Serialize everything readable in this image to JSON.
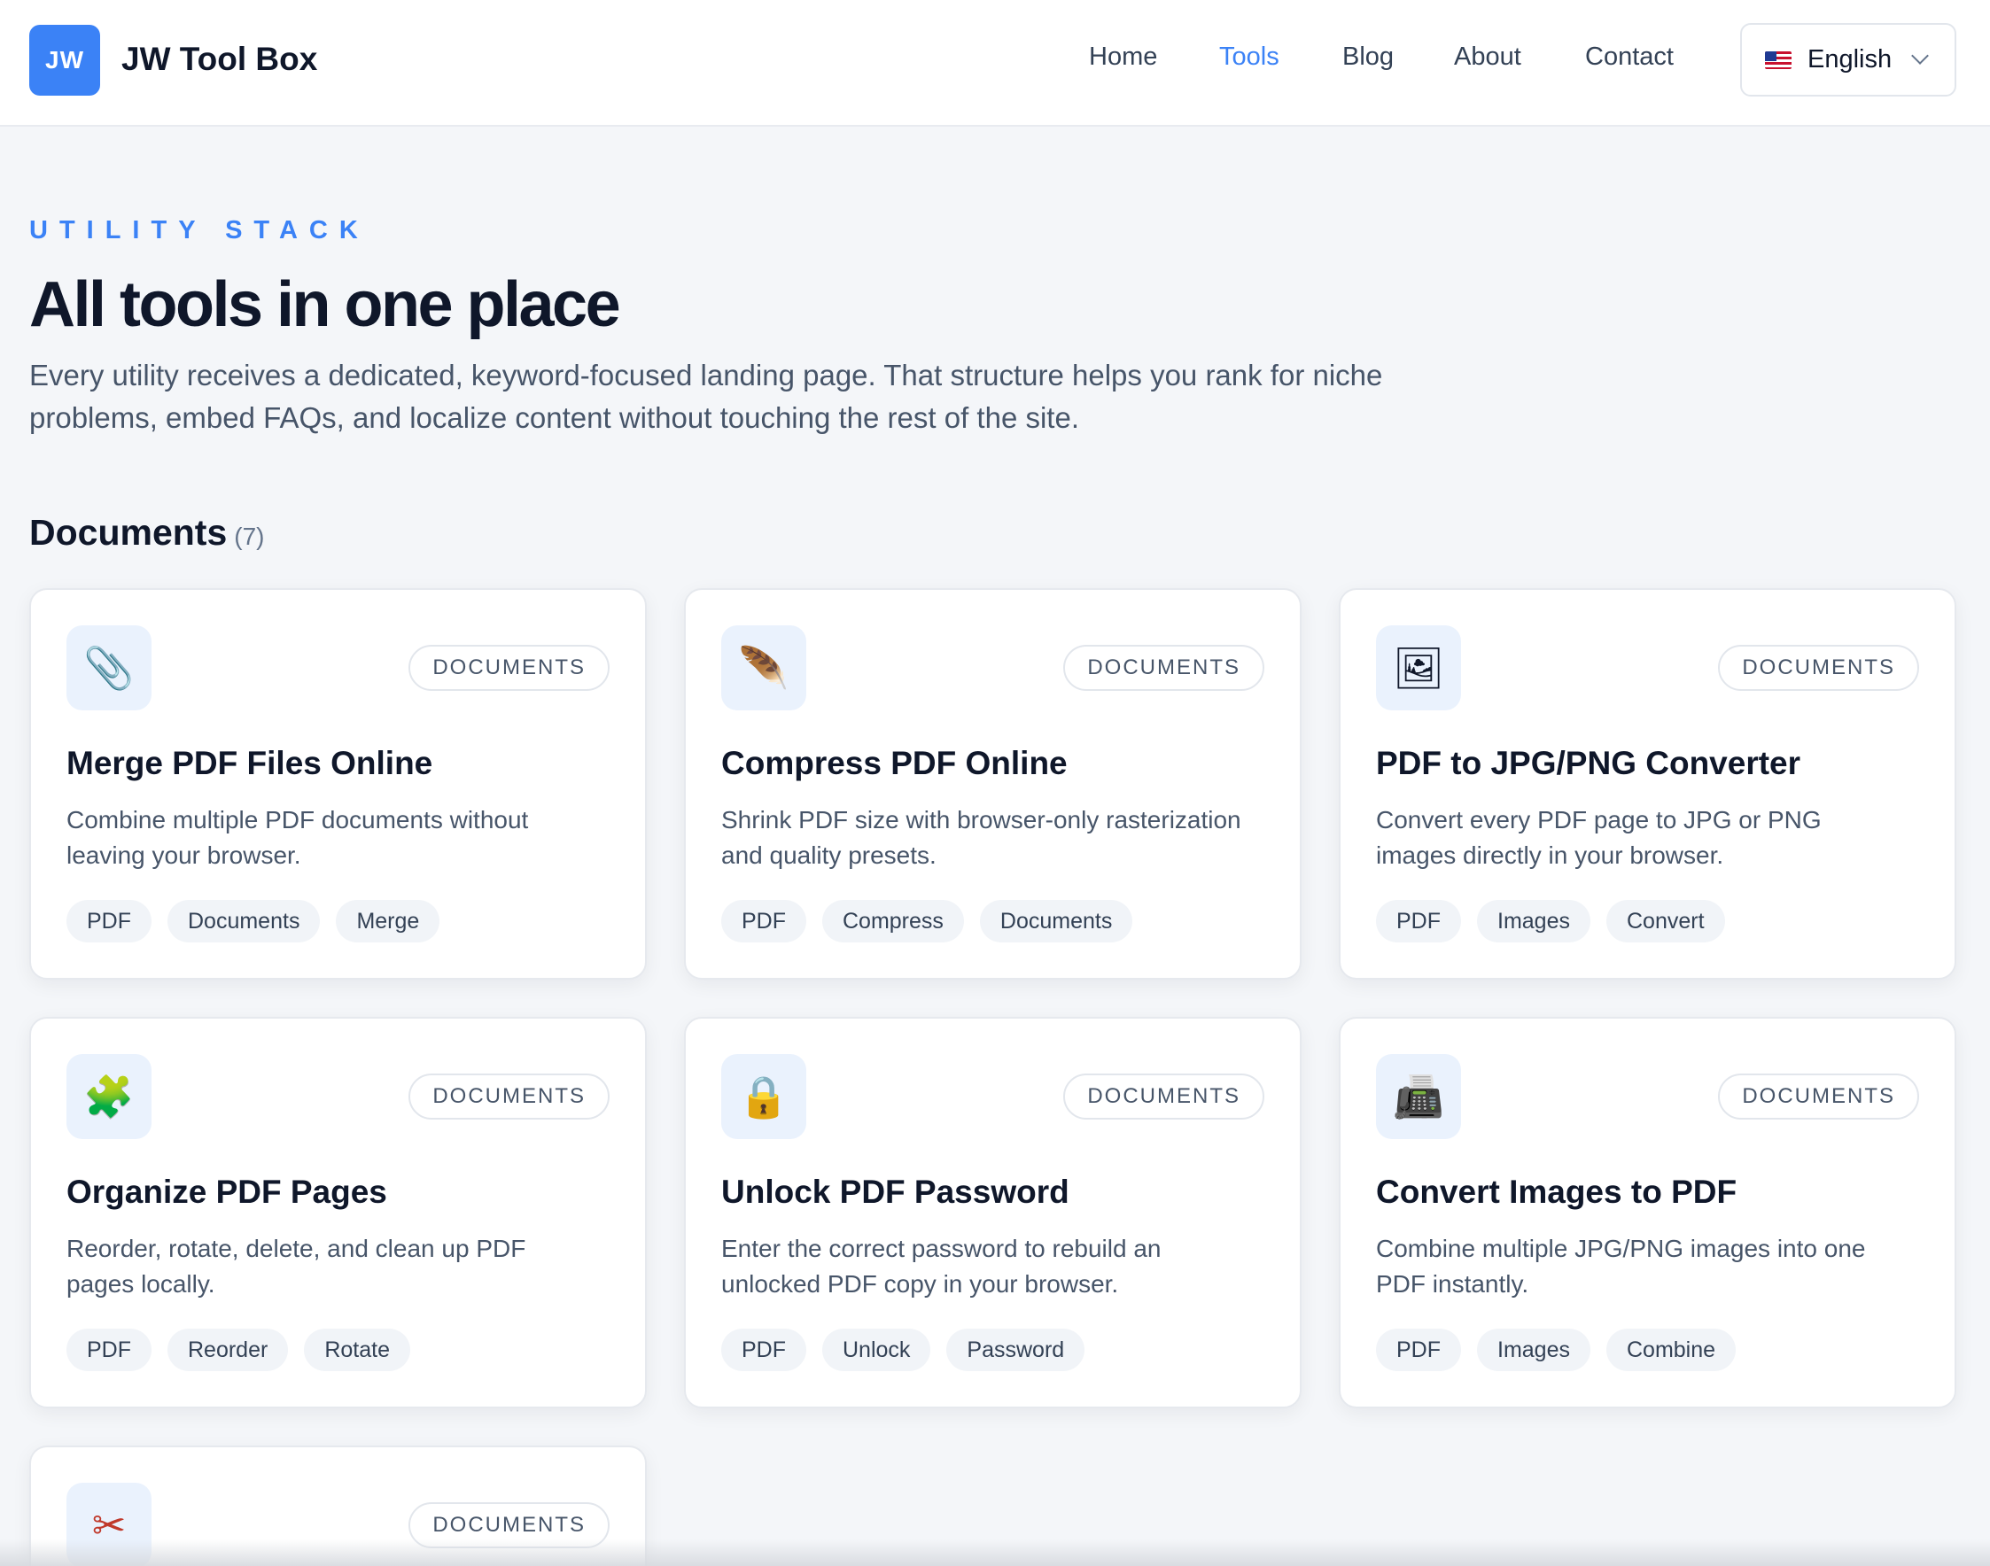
{
  "header": {
    "logo_text": "JW",
    "brand": "JW Tool Box",
    "nav": [
      "Home",
      "Tools",
      "Blog",
      "About",
      "Contact"
    ],
    "active_nav": "Tools",
    "language": "English",
    "accent_color": "#3b82f6"
  },
  "hero": {
    "eyebrow": "UTILITY STACK",
    "title": "All tools in one place",
    "description": "Every utility receives a dedicated, keyword-focused landing page. That structure helps you rank for niche problems, embed FAQs, and localize content without touching the rest of the site."
  },
  "section": {
    "title": "Documents",
    "count": "(7)"
  },
  "cards": [
    {
      "icon": "paperclip-icon",
      "glyph": "📎",
      "category": "DOCUMENTS",
      "title": "Merge PDF Files Online",
      "description": "Combine multiple PDF documents without leaving your browser.",
      "tags": [
        "PDF",
        "Documents",
        "Merge"
      ]
    },
    {
      "icon": "feather-icon",
      "glyph": "🪶",
      "category": "DOCUMENTS",
      "title": "Compress PDF Online",
      "description": "Shrink PDF size with browser-only rasterization and quality presets.",
      "tags": [
        "PDF",
        "Compress",
        "Documents"
      ]
    },
    {
      "icon": "picture-icon",
      "glyph": "🖼",
      "category": "DOCUMENTS",
      "title": "PDF to JPG/PNG Converter",
      "description": "Convert every PDF page to JPG or PNG images directly in your browser.",
      "tags": [
        "PDF",
        "Images",
        "Convert"
      ]
    },
    {
      "icon": "puzzle-icon",
      "glyph": "🧩",
      "category": "DOCUMENTS",
      "title": "Organize PDF Pages",
      "description": "Reorder, rotate, delete, and clean up PDF pages locally.",
      "tags": [
        "PDF",
        "Reorder",
        "Rotate"
      ]
    },
    {
      "icon": "lock-icon",
      "glyph": "🔒",
      "category": "DOCUMENTS",
      "title": "Unlock PDF Password",
      "description": "Enter the correct password to rebuild an unlocked PDF copy in your browser.",
      "tags": [
        "PDF",
        "Unlock",
        "Password"
      ]
    },
    {
      "icon": "fax-icon",
      "glyph": "📠",
      "category": "DOCUMENTS",
      "title": "Convert Images to PDF",
      "description": "Combine multiple JPG/PNG images into one PDF instantly.",
      "tags": [
        "PDF",
        "Images",
        "Combine"
      ]
    },
    {
      "icon": "scissors-icon",
      "glyph": "✂",
      "category": "DOCUMENTS"
    }
  ]
}
